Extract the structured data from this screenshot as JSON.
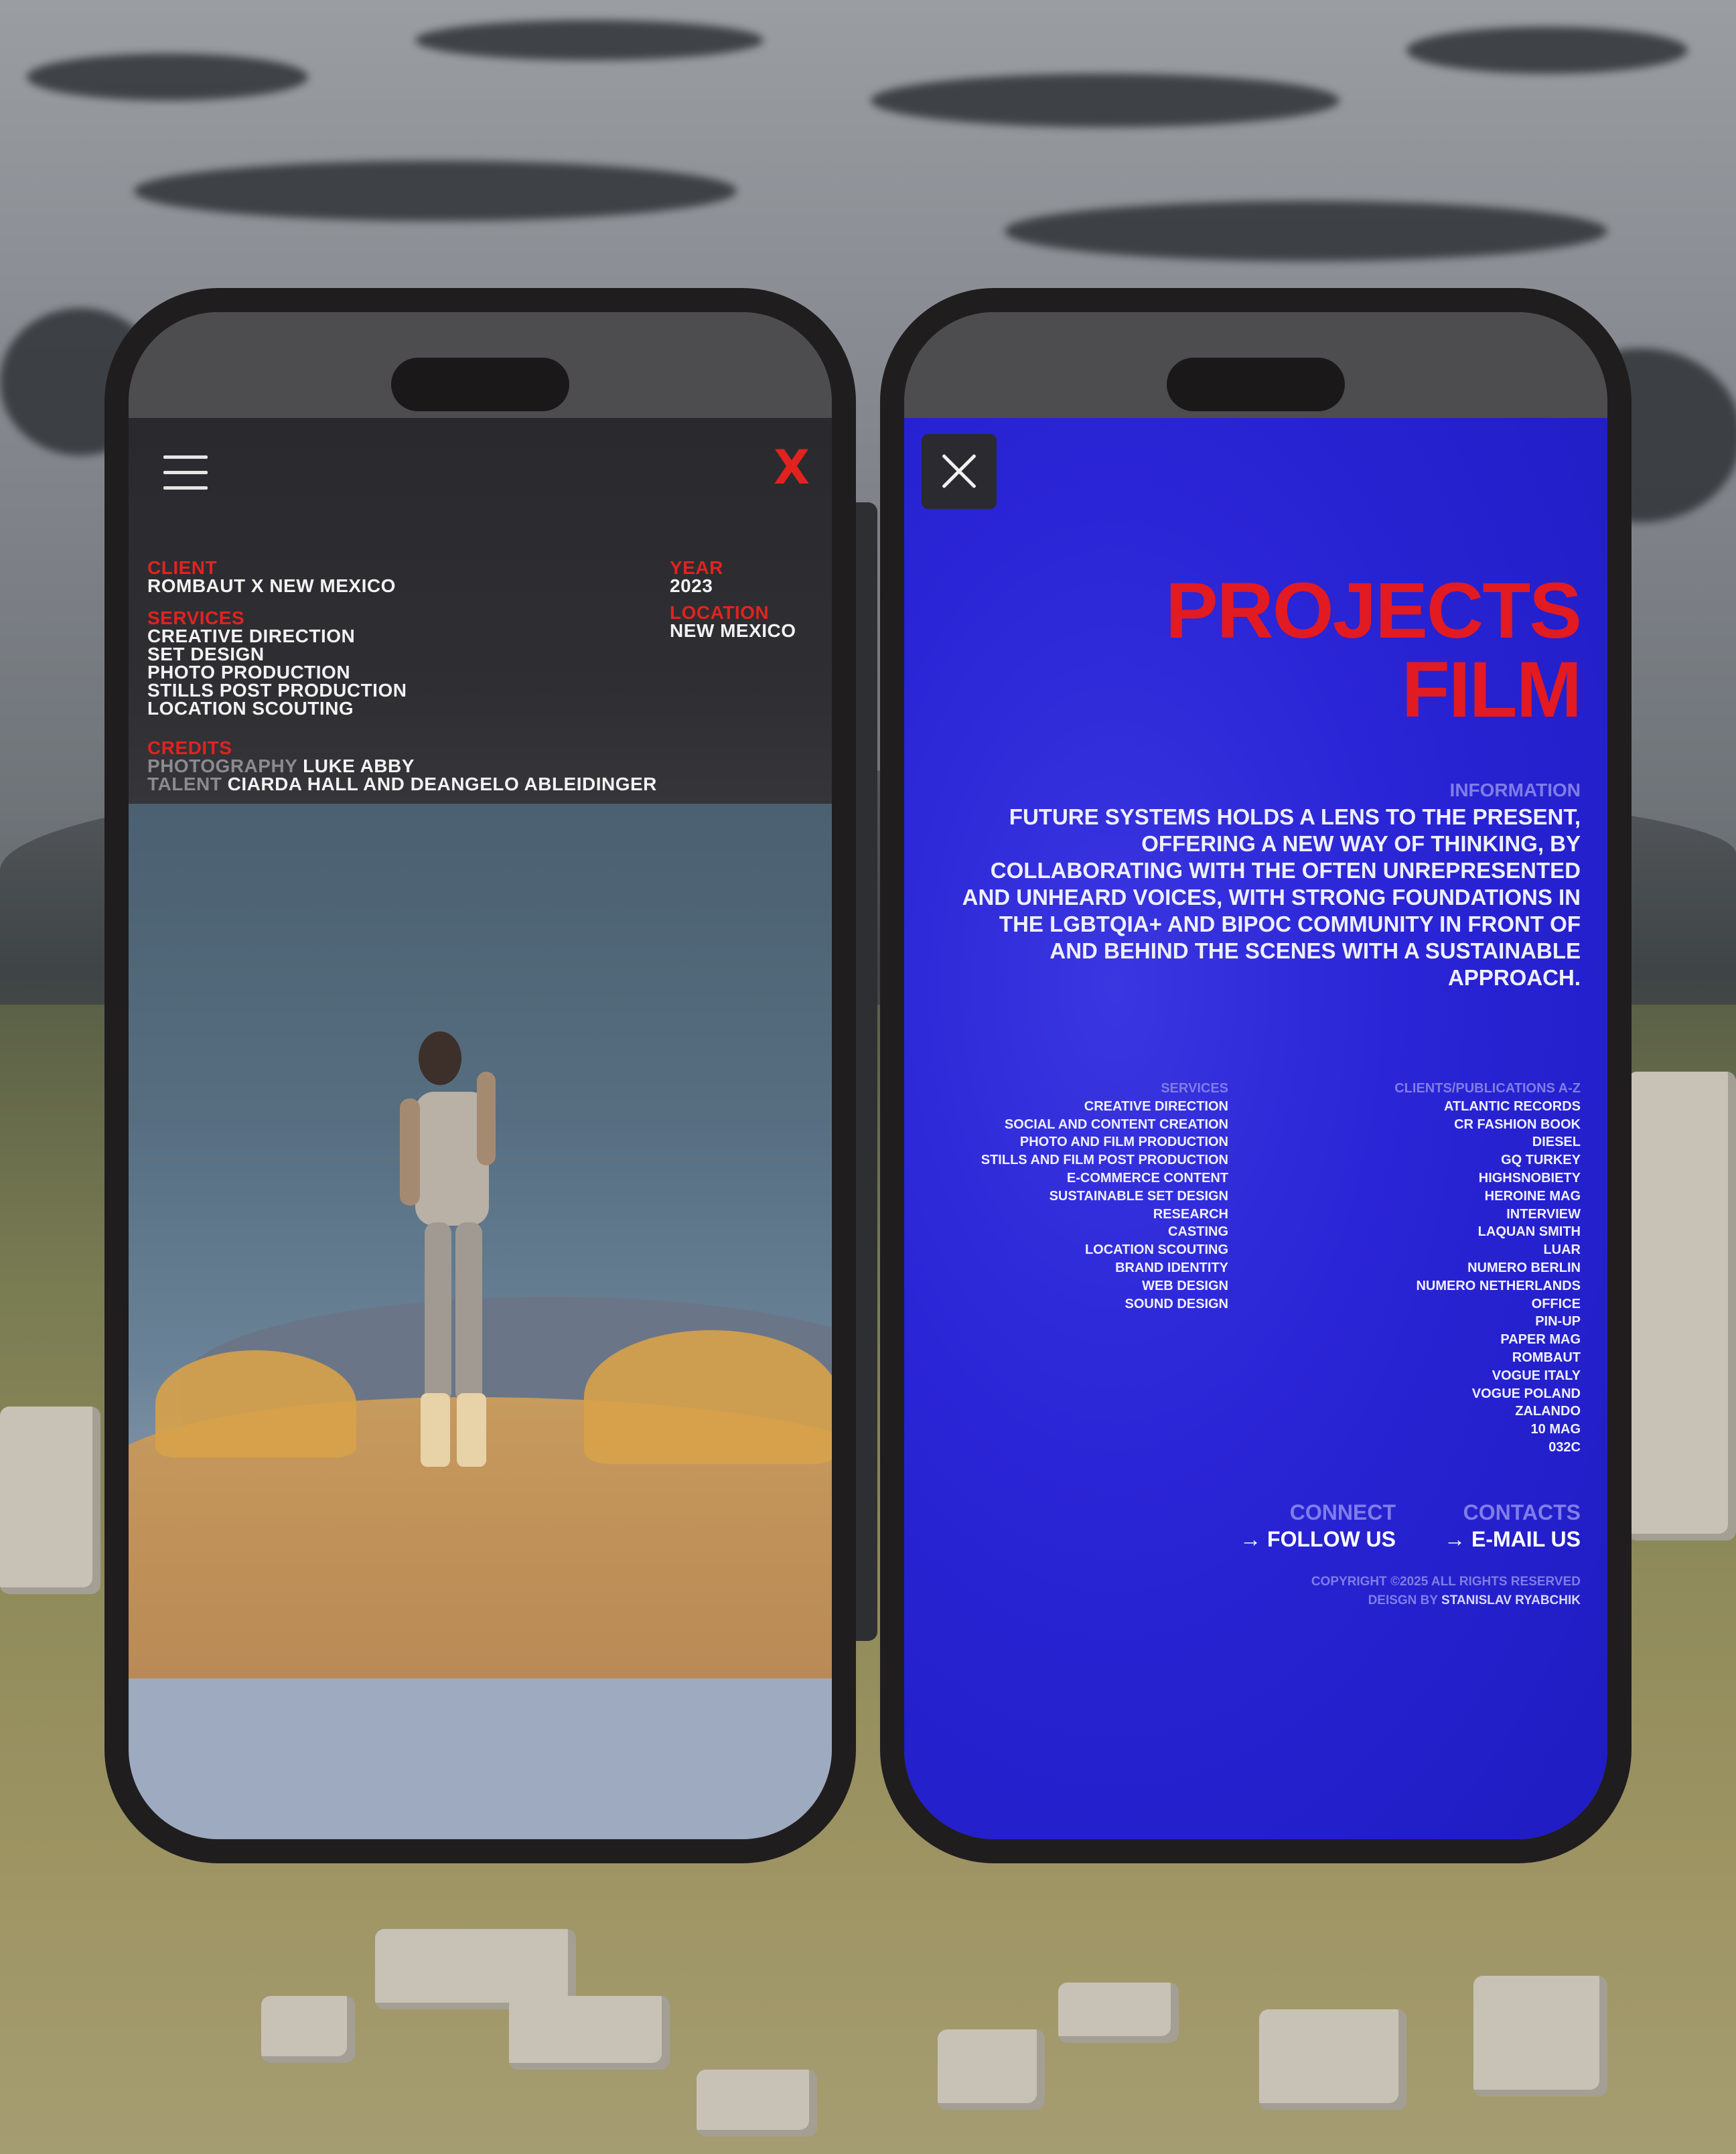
{
  "left_phone": {
    "client_label": "CLIENT",
    "client_value": "ROMBAUT X NEW MEXICO",
    "services_label": "SERVICES",
    "services": [
      "CREATIVE DIRECTION",
      "SET DESIGN",
      "PHOTO PRODUCTION",
      "STILLS POST PRODUCTION",
      "LOCATION SCOUTING"
    ],
    "year_label": "YEAR",
    "year_value": "2023",
    "location_label": "LOCATION",
    "location_value": "NEW MEXICO",
    "credits_label": "CREDITS",
    "photography_label": "PHOTOGRAPHY",
    "photography_value": "LUKE ABBY",
    "talent_label": "TALENT",
    "talent_value": "CIARDA HALL AND DEANGELO ABLEIDINGER",
    "close_glyph": "X",
    "accent_color": "#e0231f",
    "icons": [
      "menu-icon",
      "close-icon"
    ]
  },
  "right_phone": {
    "title_line1": "PROJECTS",
    "title_line2": "FILM",
    "information_label": "INFORMATION",
    "information_text": "FUTURE SYSTEMS HOLDS A LENS TO THE PRESENT, OFFERING A NEW WAY OF THINKING, BY COLLABORATING WITH THE OFTEN UNREPRESENTED AND UNHEARD VOICES, WITH STRONG FOUNDATIONS IN THE LGBTQIA+ AND BIPOC COMMUNITY IN FRONT OF AND BEHIND THE SCENES WITH A SUSTAINABLE APPROACH.",
    "services_label": "SERVICES",
    "services": [
      "CREATIVE DIRECTION",
      "SOCIAL AND CONTENT CREATION",
      "PHOTO AND FILM PRODUCTION",
      "STILLS AND FILM POST PRODUCTION",
      "E-COMMERCE CONTENT",
      "SUSTAINABLE SET DESIGN",
      "RESEARCH",
      "CASTING",
      "LOCATION SCOUTING",
      "BRAND IDENTITY",
      "WEB DESIGN",
      "SOUND DESIGN"
    ],
    "clients_label": "CLIENTS/PUBLICATIONS A-Z",
    "clients": [
      "ATLANTIC RECORDS",
      "CR FASHION BOOK",
      "DIESEL",
      "GQ TURKEY",
      "HIGHSNOBIETY",
      "HEROINE MAG",
      "INTERVIEW",
      "LAQUAN SMITH",
      "LUAR",
      "NUMERO BERLIN",
      "NUMERO NETHERLANDS",
      "OFFICE",
      "PIN-UP",
      "PAPER MAG",
      "ROMBAUT",
      "VOGUE ITALY",
      "VOGUE POLAND",
      "ZALANDO",
      "10 MAG",
      "032C"
    ],
    "connect_label": "CONNECT",
    "follow_link": "→ FOLLOW US",
    "contacts_label": "CONTACTS",
    "email_link": "→ E-MAIL US",
    "copyright": "COPYRIGHT ©2025 ALL RIGHTS RESERVED",
    "design_by_label": "DEISGN BY",
    "design_by_name": "STANISLAV RYABCHIK",
    "accent_color": "#e21a22",
    "background_color": "#2a25d6",
    "icons": [
      "close-icon"
    ]
  }
}
